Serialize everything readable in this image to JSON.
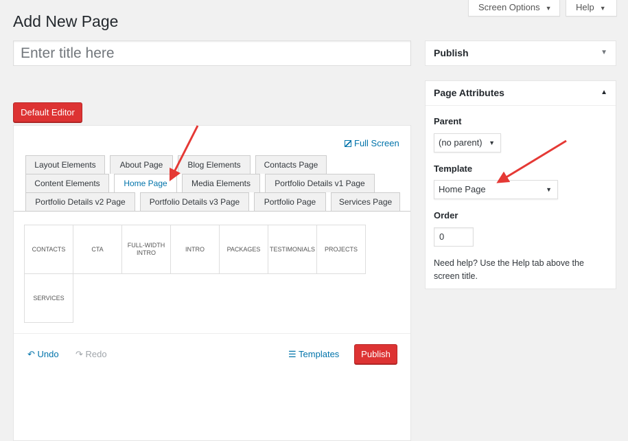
{
  "header": {
    "screen_options": "Screen Options",
    "help": "Help",
    "title": "Add New Page",
    "title_placeholder": "Enter title here"
  },
  "editor": {
    "default_editor": "Default Editor",
    "full_screen": "Full Screen",
    "tabs": [
      {
        "label": "Layout Elements"
      },
      {
        "label": "About Page"
      },
      {
        "label": "Blog Elements"
      },
      {
        "label": "Contacts Page"
      },
      {
        "label": "Content Elements"
      },
      {
        "label": "Home Page"
      },
      {
        "label": "Media Elements"
      },
      {
        "label": "Portfolio Details v1 Page"
      },
      {
        "label": "Portfolio Details v2 Page"
      },
      {
        "label": "Portfolio Details v3 Page"
      },
      {
        "label": "Portfolio Page"
      },
      {
        "label": "Services Page"
      }
    ],
    "active_tab": "Home Page",
    "elements": [
      {
        "label": "CONTACTS"
      },
      {
        "label": "CTA"
      },
      {
        "label": "FULL-WIDTH INTRO"
      },
      {
        "label": "INTRO"
      },
      {
        "label": "PACKAGES"
      },
      {
        "label": "TESTIMONIALS"
      },
      {
        "label": "PROJECTS"
      },
      {
        "label": "SERVICES"
      }
    ],
    "undo": "Undo",
    "redo": "Redo",
    "templates": "Templates",
    "publish": "Publish"
  },
  "publish_panel": {
    "title": "Publish"
  },
  "attributes_panel": {
    "title": "Page Attributes",
    "parent_label": "Parent",
    "parent_value": "(no parent)",
    "template_label": "Template",
    "template_value": "Home Page",
    "order_label": "Order",
    "order_value": "0",
    "help_text": "Need help? Use the Help tab above the screen title."
  },
  "colors": {
    "accent_red": "#dd3333",
    "link_blue": "#0073aa",
    "arrow_red": "#e53935"
  }
}
